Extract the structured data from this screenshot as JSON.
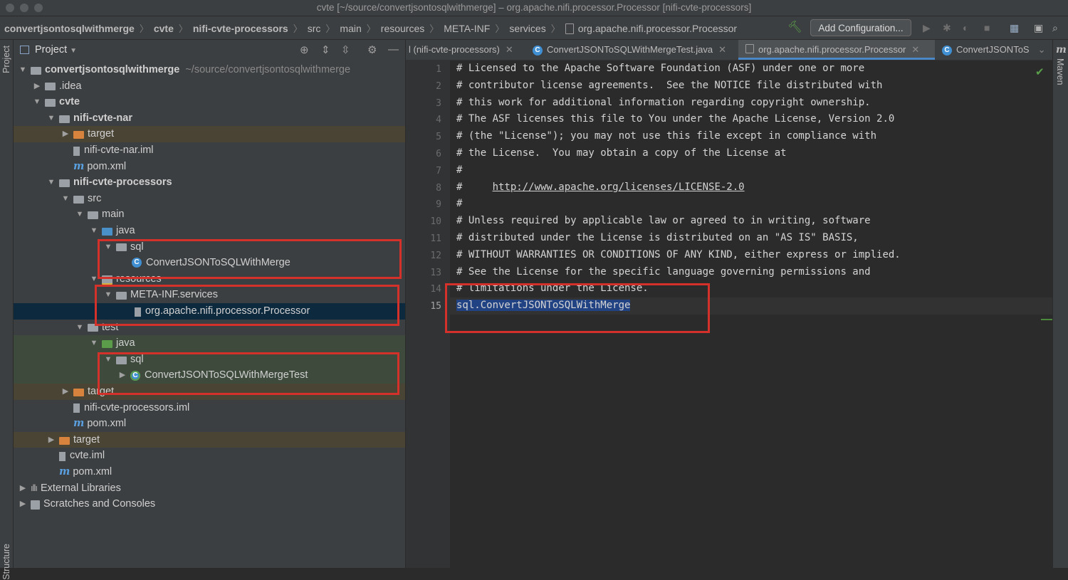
{
  "window": {
    "title": "cvte [~/source/convertjsontosqlwithmerge] – org.apache.nifi.processor.Processor [nifi-cvte-processors]"
  },
  "breadcrumb": [
    "convertjsontosqlwithmerge",
    "cvte",
    "nifi-cvte-processors",
    "src",
    "main",
    "resources",
    "META-INF",
    "services",
    "org.apache.nifi.processor.Processor"
  ],
  "toolbar": {
    "add_configuration": "Add Configuration..."
  },
  "tool_windows": {
    "left_top": "Project",
    "left_bottom": "Structure",
    "right": "Maven"
  },
  "project_panel": {
    "title": "Project",
    "tree": [
      {
        "label": "convertjsontosqlwithmerge",
        "suffix": "~/source/convertjsontosqlwithmerge",
        "icon": "module-folder-icon",
        "chev": "down"
      },
      {
        "label": ".idea",
        "icon": "folder-icon",
        "chev": "right"
      },
      {
        "label": "cvte",
        "icon": "module-folder-icon",
        "chev": "down"
      },
      {
        "label": "nifi-cvte-nar",
        "icon": "module-folder-icon",
        "chev": "down"
      },
      {
        "label": "target",
        "icon": "excluded-folder-icon",
        "chev": "right"
      },
      {
        "label": "nifi-cvte-nar.iml",
        "icon": "iml-file-icon",
        "chev": ""
      },
      {
        "label": "pom.xml",
        "icon": "maven-icon",
        "chev": ""
      },
      {
        "label": "nifi-cvte-processors",
        "icon": "module-folder-icon",
        "chev": "down"
      },
      {
        "label": "src",
        "icon": "folder-icon",
        "chev": "down"
      },
      {
        "label": "main",
        "icon": "folder-icon",
        "chev": "down"
      },
      {
        "label": "java",
        "icon": "source-folder-icon",
        "chev": "down"
      },
      {
        "label": "sql",
        "icon": "package-icon",
        "chev": "down"
      },
      {
        "label": "ConvertJSONToSQLWithMerge",
        "icon": "class-icon",
        "chev": ""
      },
      {
        "label": "resources",
        "icon": "resources-folder-icon",
        "chev": "down"
      },
      {
        "label": "META-INF.services",
        "icon": "folder-icon",
        "chev": "down"
      },
      {
        "label": "org.apache.nifi.processor.Processor",
        "icon": "text-file-icon",
        "chev": ""
      },
      {
        "label": "test",
        "icon": "folder-icon",
        "chev": "down"
      },
      {
        "label": "java",
        "icon": "test-folder-icon",
        "chev": "down"
      },
      {
        "label": "sql",
        "icon": "package-icon",
        "chev": "down"
      },
      {
        "label": "ConvertJSONToSQLWithMergeTest",
        "icon": "test-class-icon",
        "chev": "right"
      },
      {
        "label": "target",
        "icon": "excluded-folder-icon",
        "chev": "right"
      },
      {
        "label": "nifi-cvte-processors.iml",
        "icon": "iml-file-icon",
        "chev": ""
      },
      {
        "label": "pom.xml",
        "icon": "maven-icon",
        "chev": ""
      },
      {
        "label": "target",
        "icon": "excluded-folder-icon",
        "chev": "right"
      },
      {
        "label": "cvte.iml",
        "icon": "iml-file-icon",
        "chev": ""
      },
      {
        "label": "pom.xml",
        "icon": "maven-icon",
        "chev": ""
      },
      {
        "label": "External Libraries",
        "icon": "libraries-icon",
        "chev": "right"
      },
      {
        "label": "Scratches and Consoles",
        "icon": "scratches-icon",
        "chev": "right"
      }
    ]
  },
  "editor": {
    "tabs": [
      {
        "label": "l (nifi-cvte-processors)",
        "active": false
      },
      {
        "label": "ConvertJSONToSQLWithMergeTest.java",
        "active": false
      },
      {
        "label": "org.apache.nifi.processor.Processor",
        "active": true
      },
      {
        "label": "ConvertJSONToS",
        "active": false
      }
    ],
    "lines": [
      "# Licensed to the Apache Software Foundation (ASF) under one or more",
      "# contributor license agreements.  See the NOTICE file distributed with",
      "# this work for additional information regarding copyright ownership.",
      "# The ASF licenses this file to You under the Apache License, Version 2.0",
      "# (the \"License\"); you may not use this file except in compliance with",
      "# the License.  You may obtain a copy of the License at",
      "#",
      "#     http://www.apache.org/licenses/LICENSE-2.0",
      "#",
      "# Unless required by applicable law or agreed to in writing, software",
      "# distributed under the License is distributed on an \"AS IS\" BASIS,",
      "# WITHOUT WARRANTIES OR CONDITIONS OF ANY KIND, either express or implied.",
      "# See the License for the specific language governing permissions and",
      "# limitations under the License.",
      "sql.ConvertJSONToSQLWithMerge"
    ],
    "line_numbers": [
      "1",
      "2",
      "3",
      "4",
      "5",
      "6",
      "7",
      "8",
      "9",
      "10",
      "11",
      "12",
      "13",
      "14",
      "15"
    ],
    "url_prefix": "#     ",
    "url": "http://www.apache.org/licenses/LICENSE-2.0"
  },
  "colors": {
    "annotation_red": "#d4312a",
    "selection_blue": "#214283",
    "selected_row": "#0d293e"
  }
}
